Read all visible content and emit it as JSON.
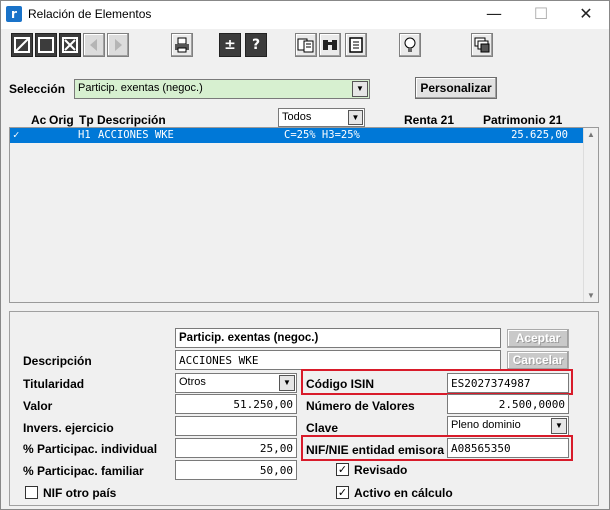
{
  "window": {
    "app_icon": "r",
    "title": "Relación de Elementos",
    "minimize": "—",
    "maximize": "☐",
    "close": "✕"
  },
  "toolbar": {
    "icons": [
      "document-edit-icon",
      "new-icon",
      "delete-icon",
      "prev-icon",
      "next-icon",
      "print-icon",
      "plus-minus-icon",
      "help-icon",
      "copy-icon",
      "binoculars-icon",
      "form-icon",
      "lightbulb-icon",
      "windows-icon"
    ],
    "plus_minus": "±",
    "help": "?"
  },
  "selection": {
    "label": "Selección",
    "value": "Particip. exentas (negoc.)",
    "personalize_button": "Personalizar"
  },
  "grid": {
    "columns": {
      "ac": "Ac",
      "orig": "Orig",
      "tp": "Tp",
      "descripcion": "Descripción",
      "filter": "Todos",
      "renta": "Renta 21",
      "patrimonio": "Patrimonio 21"
    },
    "rows": [
      {
        "check": "✓",
        "tp": "H1",
        "descripcion": "ACCIONES WKE",
        "detail": "C=25% H3=25%",
        "renta": "",
        "patrimonio": "25.625,00"
      }
    ]
  },
  "form": {
    "header_value": "Particip. exentas (negoc.)",
    "accept_button": "Aceptar",
    "cancel_button": "Cancelar",
    "descripcion_label": "Descripción",
    "descripcion_value": "ACCIONES WKE",
    "titularidad_label": "Titularidad",
    "titularidad_value": "Otros",
    "valor_label": "Valor",
    "valor_value": "51.250,00",
    "invers_label": "Invers. ejercicio",
    "invers_value": "",
    "particip_ind_label": "% Participac. individual",
    "particip_ind_value": "25,00",
    "particip_fam_label": "% Participac. familiar",
    "particip_fam_value": "50,00",
    "nif_otro_label": "NIF otro país",
    "isin_label": "Código ISIN",
    "isin_value": "ES2027374987",
    "num_valores_label": "Número de Valores",
    "num_valores_value": "2.500,0000",
    "clave_label": "Clave",
    "clave_value": "Pleno dominio",
    "nif_emisora_label": "NIF/NIE entidad emisora",
    "nif_emisora_value": "A08565350",
    "revisado_label": "Revisado",
    "activo_label": "Activo en cálculo",
    "check_mark": "✓"
  },
  "colors": {
    "highlight_red": "#d81b2a",
    "selected_row": "#0078d7",
    "combo_green": "#d7f0d0"
  }
}
